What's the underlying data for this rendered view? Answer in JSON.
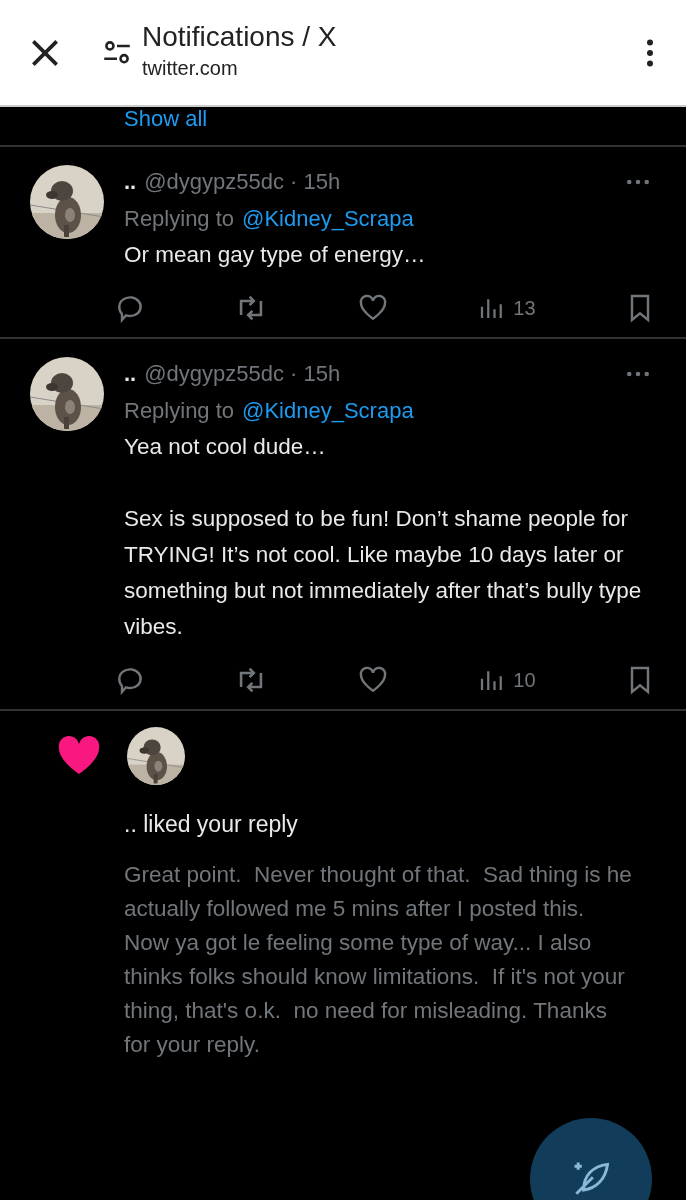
{
  "browser_bar": {
    "title": "Notifications / X",
    "url": "twitter.com"
  },
  "show_all": "Show all",
  "tweets": [
    {
      "name": "..",
      "meta": "@dygypz55dc · 15h",
      "replying_label": "Replying to",
      "replying_to": "@Kidney_Scrapa",
      "paragraphs": [
        "Or mean gay type of energy…"
      ],
      "views": "13"
    },
    {
      "name": "..",
      "meta": "@dygypz55dc · 15h",
      "replying_label": "Replying to",
      "replying_to": "@Kidney_Scrapa",
      "paragraphs": [
        "Yea not cool dude…",
        "Sex is supposed to be fun! Don’t shame people for TRYING! It’s not cool. Like maybe 10 days later or something but not immediately after that’s bully type vibes."
      ],
      "views": "10"
    }
  ],
  "like_notification": {
    "text": ".. liked your reply",
    "quote": "Great point.  Never thought of that.  Sad thing is he actually followed me 5 mins after I posted this.  Now ya got le feeling some type of way... I also thinks folks should know limitations.  If it's not your thing, that's o.k.  no need for misleading. Thanks for your reply."
  }
}
